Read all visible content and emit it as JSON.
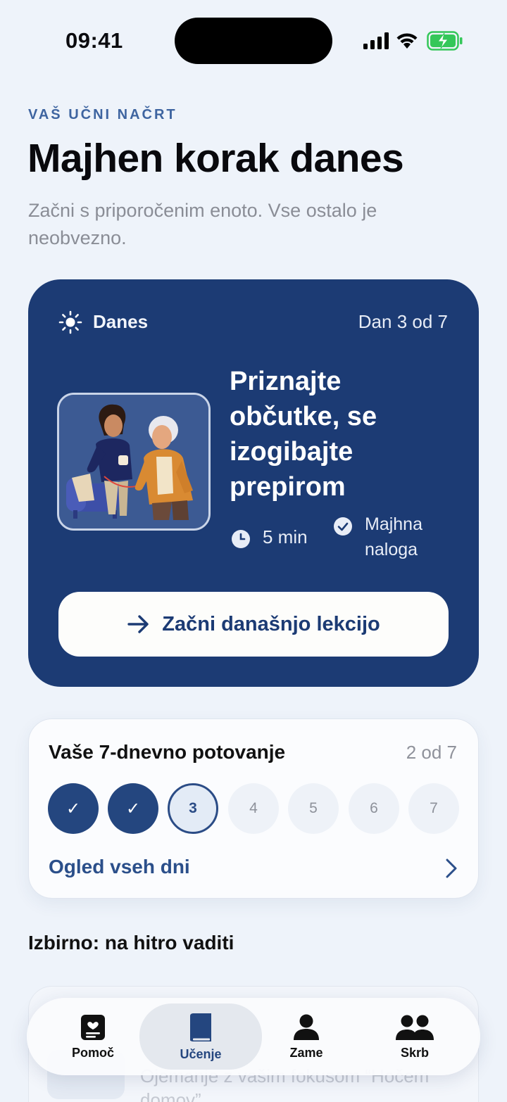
{
  "status_bar": {
    "time": "09:41"
  },
  "header": {
    "eyebrow": "VAŠ UČNI NAČRT",
    "title": "Majhen korak danes",
    "subtitle": "Začni s priporočenim enoto. Vse ostalo je neobvezno."
  },
  "today_card": {
    "label": "Danes",
    "day_progress": "Dan 3 od 7",
    "lesson_title": "Priznajte občutke, se izogibajte prepirom",
    "duration": "5 min",
    "task_type": "Majhna naloga",
    "start_button": "Začni današnjo lekcijo",
    "image_icon": "caregiver-illustration"
  },
  "journey": {
    "title": "Vaše 7-dnevno potovanje",
    "count": "2 od 7",
    "days": [
      {
        "label": "✓",
        "state": "done"
      },
      {
        "label": "✓",
        "state": "done"
      },
      {
        "label": "3",
        "state": "current"
      },
      {
        "label": "4",
        "state": "todo"
      },
      {
        "label": "5",
        "state": "todo"
      },
      {
        "label": "6",
        "state": "todo"
      },
      {
        "label": "7",
        "state": "todo"
      }
    ],
    "link": "Ogled vseh dni"
  },
  "optional": {
    "heading": "Izbirno: na hitro vaditi",
    "card_text": "Ojemanje z vašim fokusom “Hočem domov”"
  },
  "tab_bar": {
    "tabs": [
      {
        "label": "Pomoč",
        "icon": "help-card-icon",
        "active": false
      },
      {
        "label": "Učenje",
        "icon": "book-icon",
        "active": true
      },
      {
        "label": "Zame",
        "icon": "person-icon",
        "active": false
      },
      {
        "label": "Skrb",
        "icon": "people-icon",
        "active": false
      }
    ]
  },
  "colors": {
    "accent": "#1c3b74",
    "background": "#eef3fa",
    "link": "#2b4f8a",
    "battery": "#34c759"
  }
}
